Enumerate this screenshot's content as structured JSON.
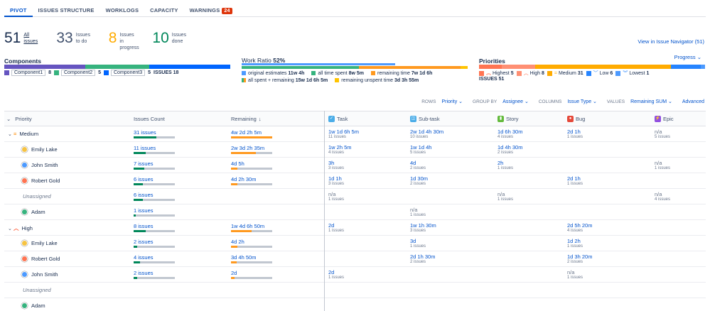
{
  "tabs": [
    {
      "label": "PIVOT"
    },
    {
      "label": "ISSUES STRUCTURE"
    },
    {
      "label": "WORKLOGS"
    },
    {
      "label": "CAPACITY"
    },
    {
      "label": "WARNINGS",
      "badge": "24"
    }
  ],
  "summary": {
    "all": {
      "num": "51",
      "l1": "All",
      "l2": "issues"
    },
    "todo": {
      "num": "33",
      "l1": "Issues",
      "l2": "to do"
    },
    "progress": {
      "num": "8",
      "l1": "Issues",
      "l2": "in progress"
    },
    "done": {
      "num": "10",
      "l1": "Issues",
      "l2": "done"
    },
    "nav_link": "View in Issue Navigator (51)"
  },
  "components": {
    "title": "Components",
    "items": [
      {
        "name": "Component1",
        "count": "8",
        "color": "#6554c0"
      },
      {
        "name": "Component2",
        "count": "5",
        "color": "#36b37e"
      },
      {
        "name": "Component3",
        "count": "5",
        "color": "#0065ff"
      }
    ],
    "issues_label": "ISSUES 18"
  },
  "work_ratio": {
    "title": "Work Ratio",
    "pct": "52%",
    "legend": [
      {
        "label": "original estimates",
        "value": "11w 4h",
        "color": "#4c9aff"
      },
      {
        "label": "all time spent",
        "value": "8w 5m",
        "color": "#36b37e"
      },
      {
        "label": "remaining time",
        "value": "7w 1d 6h",
        "color": "#ff991f"
      },
      {
        "label": "all spent + remaining",
        "value": "15w 1d 6h 5m",
        "color": "#57d9a3"
      },
      {
        "label": "remaining unspent time",
        "value": "3d 3h 55m",
        "color": "#ffc400"
      }
    ]
  },
  "priorities": {
    "title": "Priorities",
    "dropdown": "Progress",
    "items": [
      {
        "name": "Highest",
        "count": "5",
        "color": "#ff7452"
      },
      {
        "name": "High",
        "count": "8",
        "color": "#ff8f73"
      },
      {
        "name": "Medium",
        "count": "31",
        "color": "#ffab00"
      },
      {
        "name": "Low",
        "count": "6",
        "color": "#2684ff"
      },
      {
        "name": "Lowest",
        "count": "1",
        "color": "#4c9aff"
      }
    ],
    "issues_label": "ISSUES 51"
  },
  "toolbar": {
    "rows_k": "ROWS",
    "rows_v": "Priority",
    "group_k": "GROUP BY",
    "group_v": "Assignee",
    "cols_k": "COLUMNS",
    "cols_v": "Issue Type",
    "vals_k": "VALUES",
    "vals_v": "Remaining SUM",
    "advanced": "Advanced"
  },
  "header": {
    "priority": "Priority",
    "count": "Issues Count",
    "remaining": "Remaining",
    "task": "Task",
    "subtask": "Sub-task",
    "story": "Story",
    "bug": "Bug",
    "epic": "Epic"
  },
  "rows": [
    {
      "name": "Medium",
      "group": "medium",
      "count": "31 issues",
      "cfill": 0.55,
      "remaining": "4w 2d 2h 5m",
      "rfill": 1.0,
      "task": [
        "1w 1d 6h 5m",
        "11 issues"
      ],
      "subtask": [
        "2w 1d 4h 30m",
        "10 issues"
      ],
      "story": [
        "1d 6h 30m",
        "4 issues"
      ],
      "bug": [
        "2d 1h",
        "1 issues"
      ],
      "epic": [
        "n/a",
        "5 issues"
      ]
    },
    {
      "name": "Emily Lake",
      "avatar": "#f6c342",
      "count": "11 issues",
      "cfill": 0.3,
      "remaining": "2w 3d 2h 35m",
      "rfill": 0.6,
      "task": [
        "1w 2h 5m",
        "4 issues"
      ],
      "subtask": [
        "1w 1d 4h",
        "5 issues"
      ],
      "story": [
        "1d 4h 30m",
        "2 issues"
      ],
      "bug": [
        "",
        ""
      ],
      "epic": [
        "",
        ""
      ]
    },
    {
      "name": "John Smith",
      "avatar": "#4c9aff",
      "count": "7 issues",
      "cfill": 0.25,
      "remaining": "4d 5h",
      "rfill": 0.15,
      "task": [
        "3h",
        "3 issues"
      ],
      "subtask": [
        "4d",
        "2 issues"
      ],
      "story": [
        "2h",
        "1 issues"
      ],
      "bug": [
        "",
        ""
      ],
      "epic": [
        "n/a",
        "1 issues"
      ]
    },
    {
      "name": "Robert Gold",
      "avatar": "#ff7452",
      "count": "6 issues",
      "cfill": 0.22,
      "remaining": "4d 2h 30m",
      "rfill": 0.15,
      "task": [
        "1d 1h",
        "3 issues"
      ],
      "subtask": [
        "1d 30m",
        "2 issues"
      ],
      "story": [
        "",
        ""
      ],
      "bug": [
        "2d 1h",
        "1 issues"
      ],
      "epic": [
        "",
        ""
      ]
    },
    {
      "name": "Unassigned",
      "italic": true,
      "count": "6 issues",
      "cfill": 0.22,
      "remaining": "",
      "rfill": 0,
      "task": [
        "n/a",
        "1 issues"
      ],
      "subtask": [
        "",
        ""
      ],
      "story": [
        "n/a",
        "1 issues"
      ],
      "bug": [
        "",
        ""
      ],
      "epic": [
        "n/a",
        "4 issues"
      ]
    },
    {
      "name": "Adam",
      "avatar": "#36b37e",
      "count": "1 issues",
      "cfill": 0.05,
      "remaining": "",
      "rfill": 0,
      "task": [
        "",
        ""
      ],
      "subtask": [
        "n/a",
        "1 issues"
      ],
      "story": [
        "",
        ""
      ],
      "bug": [
        "",
        ""
      ],
      "epic": [
        "",
        ""
      ]
    },
    {
      "name": "High",
      "group": "high",
      "count": "8 issues",
      "cfill": 0.3,
      "remaining": "1w 4d 6h 50m",
      "rfill": 0.5,
      "task": [
        "2d",
        "1 issues"
      ],
      "subtask": [
        "1w 1h 30m",
        "3 issues"
      ],
      "story": [
        "",
        ""
      ],
      "bug": [
        "2d 5h 20m",
        "4 issues"
      ],
      "epic": [
        "",
        ""
      ]
    },
    {
      "name": "Emily Lake",
      "avatar": "#f6c342",
      "count": "2 issues",
      "cfill": 0.08,
      "remaining": "4d 2h",
      "rfill": 0.15,
      "task": [
        "",
        ""
      ],
      "subtask": [
        "3d",
        "1 issues"
      ],
      "story": [
        "",
        ""
      ],
      "bug": [
        "1d 2h",
        "1 issues"
      ],
      "epic": [
        "",
        ""
      ]
    },
    {
      "name": "Robert Gold",
      "avatar": "#ff7452",
      "count": "4 issues",
      "cfill": 0.15,
      "remaining": "3d 4h 50m",
      "rfill": 0.13,
      "task": [
        "",
        ""
      ],
      "subtask": [
        "2d 1h 30m",
        "2 issues"
      ],
      "story": [
        "",
        ""
      ],
      "bug": [
        "1d 3h 20m",
        "2 issues"
      ],
      "epic": [
        "",
        ""
      ]
    },
    {
      "name": "John Smith",
      "avatar": "#4c9aff",
      "count": "2 issues",
      "cfill": 0.08,
      "remaining": "2d",
      "rfill": 0.08,
      "task": [
        "2d",
        "1 issues"
      ],
      "subtask": [
        "",
        ""
      ],
      "story": [
        "",
        ""
      ],
      "bug": [
        "n/a",
        "1 issues"
      ],
      "epic": [
        "",
        ""
      ]
    },
    {
      "name": "Unassigned",
      "italic": true,
      "count": "",
      "cfill": 0,
      "remaining": "",
      "rfill": 0,
      "task": [
        "",
        ""
      ],
      "subtask": [
        "",
        ""
      ],
      "story": [
        "",
        ""
      ],
      "bug": [
        "",
        ""
      ],
      "epic": [
        "",
        ""
      ]
    },
    {
      "name": "Adam",
      "avatar": "#36b37e",
      "count": "",
      "cfill": 0,
      "remaining": "",
      "rfill": 0,
      "task": [
        "",
        ""
      ],
      "subtask": [
        "",
        ""
      ],
      "story": [
        "",
        ""
      ],
      "bug": [
        "",
        ""
      ],
      "epic": [
        "",
        ""
      ]
    }
  ]
}
